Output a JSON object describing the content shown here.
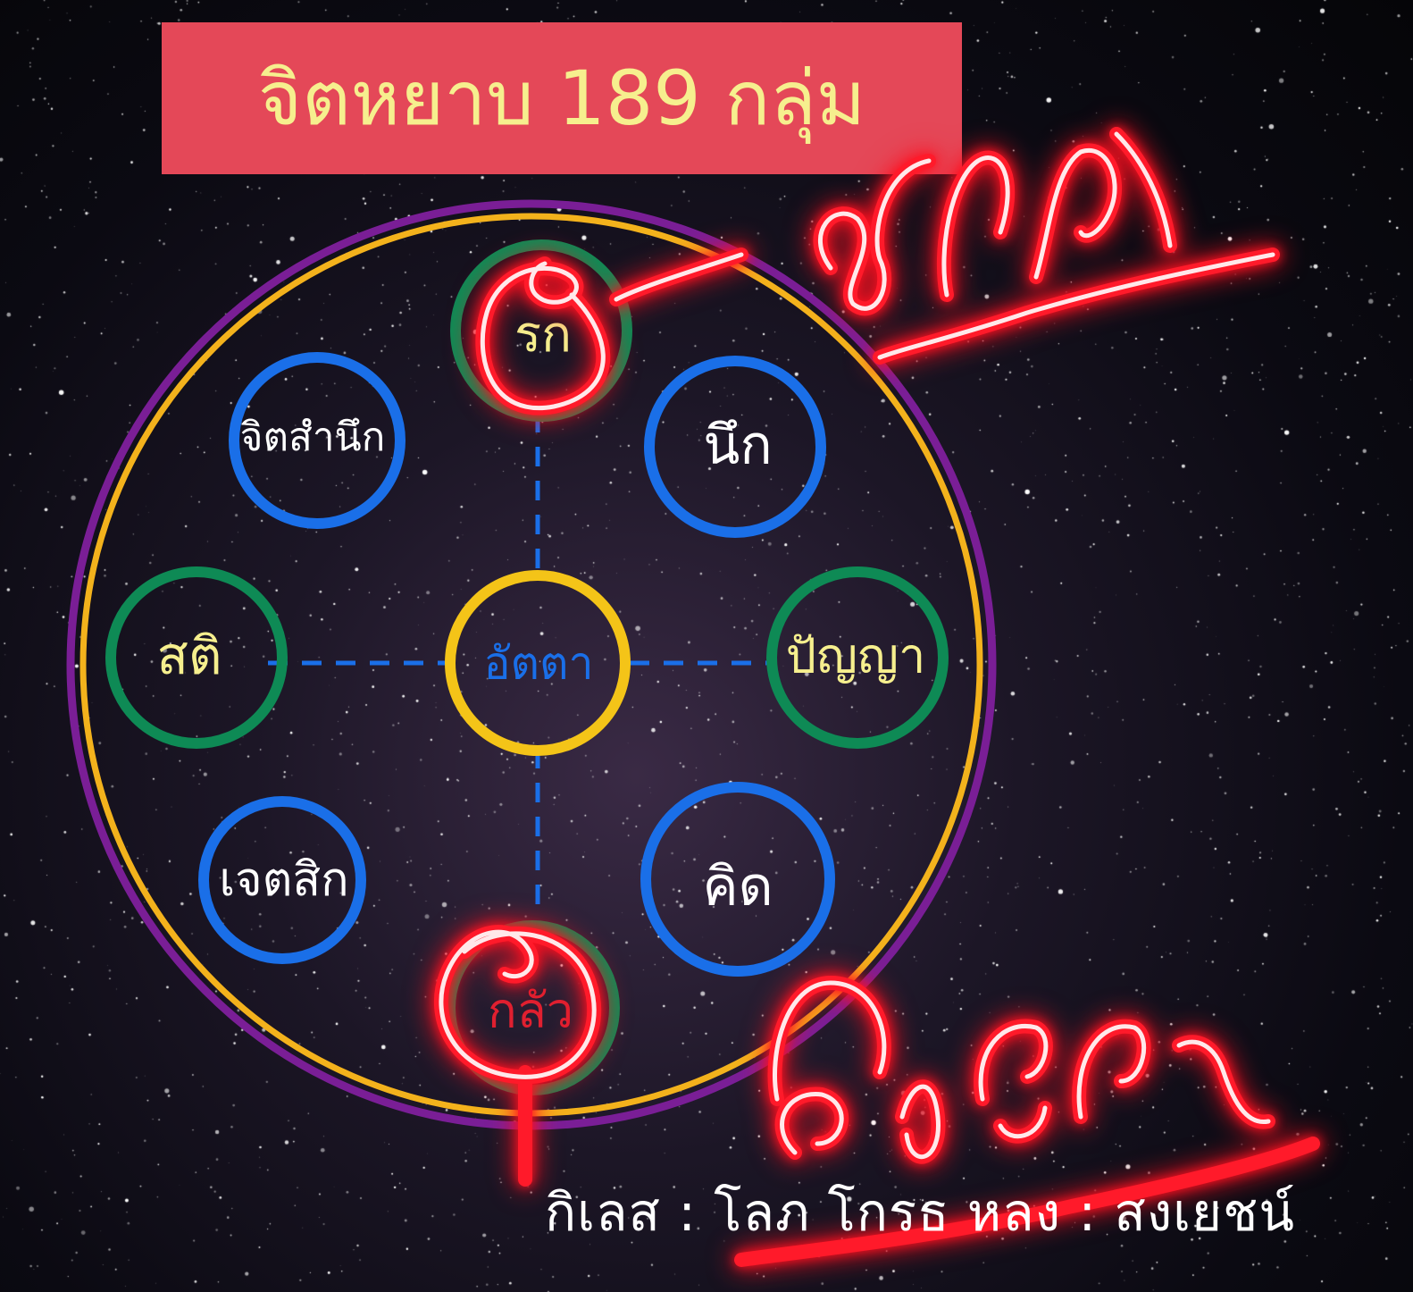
{
  "title": "จิตหยาบ 189 กลุ่ม",
  "nodes": {
    "rak": "รก",
    "nuek": "นึก",
    "jitsamnuek": "จิตสำนึก",
    "sati": "สติ",
    "atta": "อัตตา",
    "panya": "ปัญญา",
    "jetasik": "เจตสิก",
    "khit": "คิด",
    "klua": "กลัว"
  },
  "caption": "กิเลส : โลภ โกรธ หลง : สงเยชน์",
  "colors": {
    "title_bg": "#e44858",
    "title_text": "#f6ef8e",
    "outer_ring_purple": "#7a1e96",
    "outer_ring_gold": "#f3b21c",
    "blue_ring": "#1a6fe8",
    "green_ring": "#0e8a55",
    "yellow_ring": "#f4c418",
    "neon_red": "#ff2030"
  }
}
